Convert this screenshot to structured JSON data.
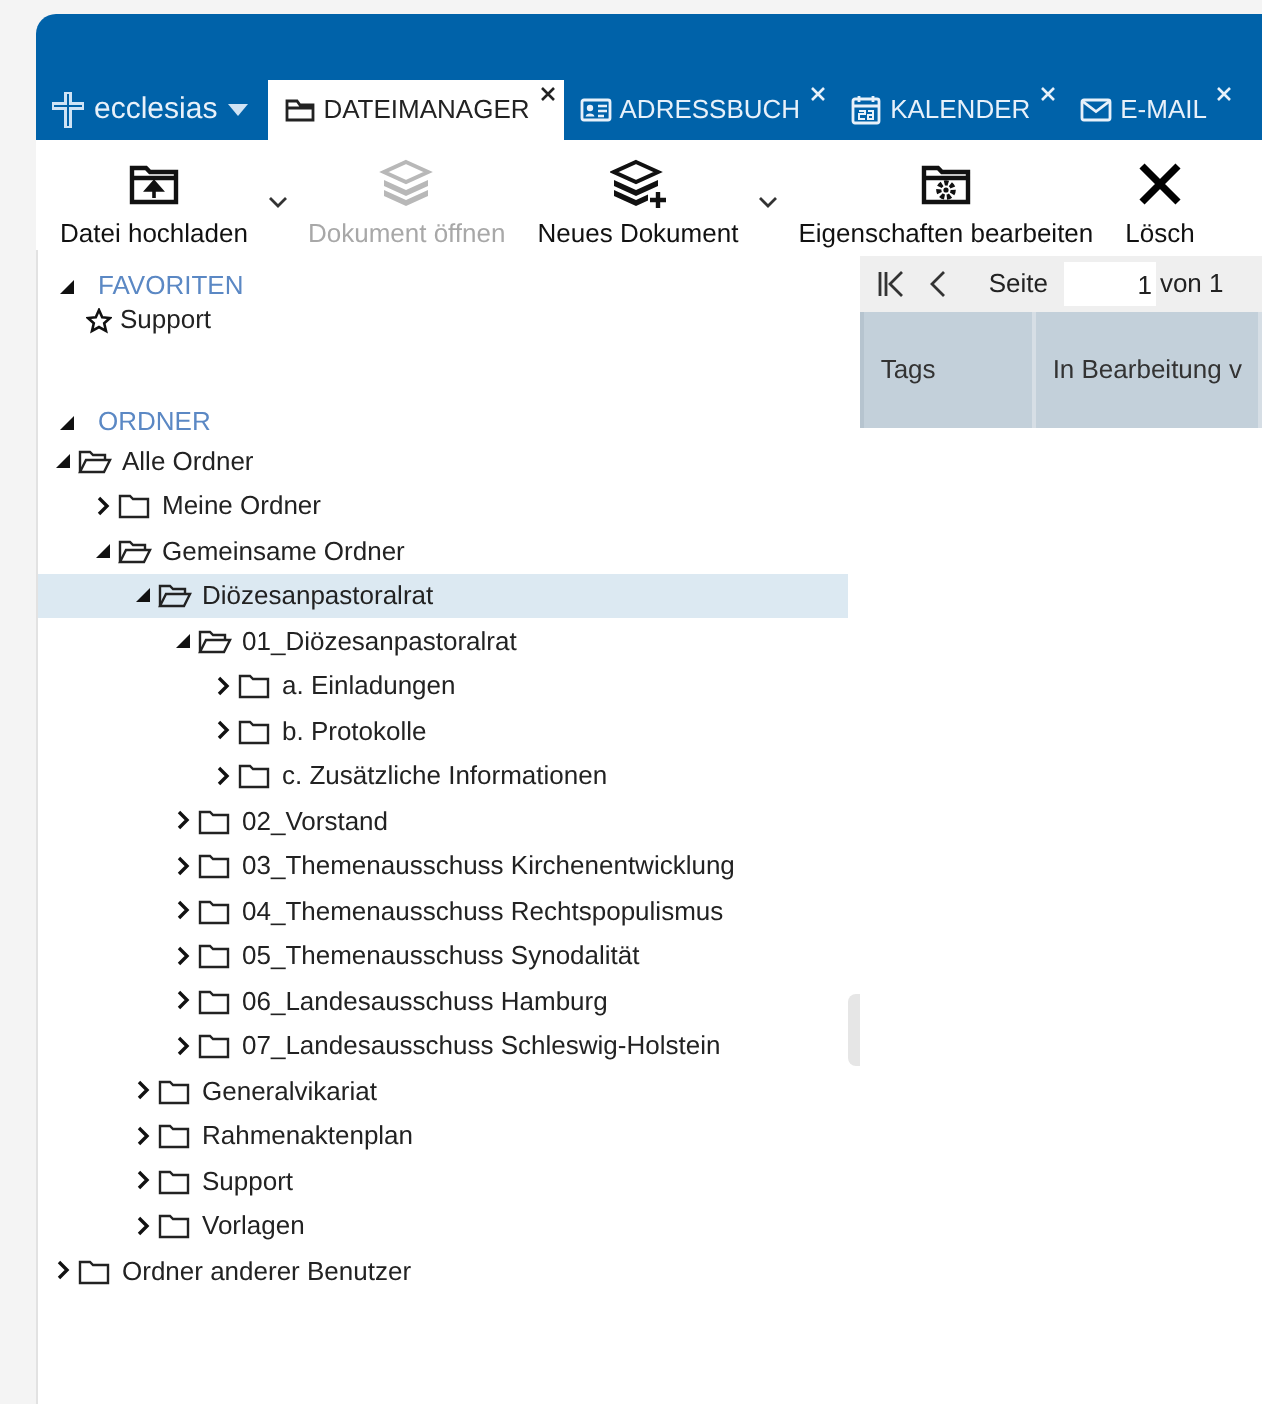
{
  "brand": {
    "label": "ecclesias"
  },
  "tabs": [
    {
      "label": "DATEIMANAGER",
      "selected": true
    },
    {
      "label": "ADRESSBUCH",
      "selected": false
    },
    {
      "label": "KALENDER",
      "selected": false
    },
    {
      "label": "E-MAIL",
      "selected": false
    }
  ],
  "toolbar": [
    {
      "label": "Datei hochladen",
      "disabled": false,
      "dropdown": true
    },
    {
      "label": "Dokument öffnen",
      "disabled": true,
      "dropdown": false
    },
    {
      "label": "Neues Dokument",
      "disabled": false,
      "dropdown": true
    },
    {
      "label": "Eigenschaften bearbeiten",
      "disabled": false,
      "dropdown": false
    },
    {
      "label": "Lösch",
      "disabled": false,
      "dropdown": false
    }
  ],
  "sections": [
    {
      "title": "FAVORITEN",
      "expanded": true,
      "kind": "favorites",
      "items": [
        {
          "label": "Support"
        }
      ]
    },
    {
      "title": "ORDNER",
      "expanded": true,
      "kind": "tree",
      "tree": [
        {
          "label": "Alle Ordner",
          "expanded": true,
          "selected": false,
          "children": [
            {
              "label": "Meine Ordner",
              "expanded": false,
              "selected": false
            },
            {
              "label": "Gemeinsame Ordner",
              "expanded": true,
              "selected": false,
              "children": [
                {
                  "label": "Diözesanpastoralrat",
                  "expanded": true,
                  "selected": true,
                  "children": [
                    {
                      "label": "01_Diözesanpastoralrat",
                      "expanded": true,
                      "selected": false,
                      "children": [
                        {
                          "label": "a. Einladungen",
                          "expanded": false,
                          "selected": false
                        },
                        {
                          "label": "b. Protokolle",
                          "expanded": false,
                          "selected": false
                        },
                        {
                          "label": "c. Zusätzliche Informationen",
                          "expanded": false,
                          "selected": false
                        }
                      ]
                    },
                    {
                      "label": "02_Vorstand",
                      "expanded": false,
                      "selected": false
                    },
                    {
                      "label": "03_Themenausschuss Kirchenentwicklung",
                      "expanded": false,
                      "selected": false
                    },
                    {
                      "label": "04_Themenausschuss Rechtspopulismus",
                      "expanded": false,
                      "selected": false
                    },
                    {
                      "label": "05_Themenausschuss Synodalität",
                      "expanded": false,
                      "selected": false
                    },
                    {
                      "label": "06_Landesausschuss Hamburg",
                      "expanded": false,
                      "selected": false
                    },
                    {
                      "label": "07_Landesausschuss Schleswig-Holstein",
                      "expanded": false,
                      "selected": false
                    }
                  ]
                },
                {
                  "label": "Generalvikariat",
                  "expanded": false,
                  "selected": false
                },
                {
                  "label": "Rahmenaktenplan",
                  "expanded": false,
                  "selected": false
                },
                {
                  "label": "Support",
                  "expanded": false,
                  "selected": false
                },
                {
                  "label": "Vorlagen",
                  "expanded": false,
                  "selected": false
                }
              ]
            }
          ]
        },
        {
          "label": "Ordner anderer Benutzer",
          "expanded": false,
          "selected": false
        }
      ]
    }
  ],
  "pager": {
    "page_label": "Seite",
    "page": "1",
    "of_label": "von 1"
  },
  "table": {
    "columns": [
      "Tags",
      "In Bearbeitung v"
    ]
  }
}
